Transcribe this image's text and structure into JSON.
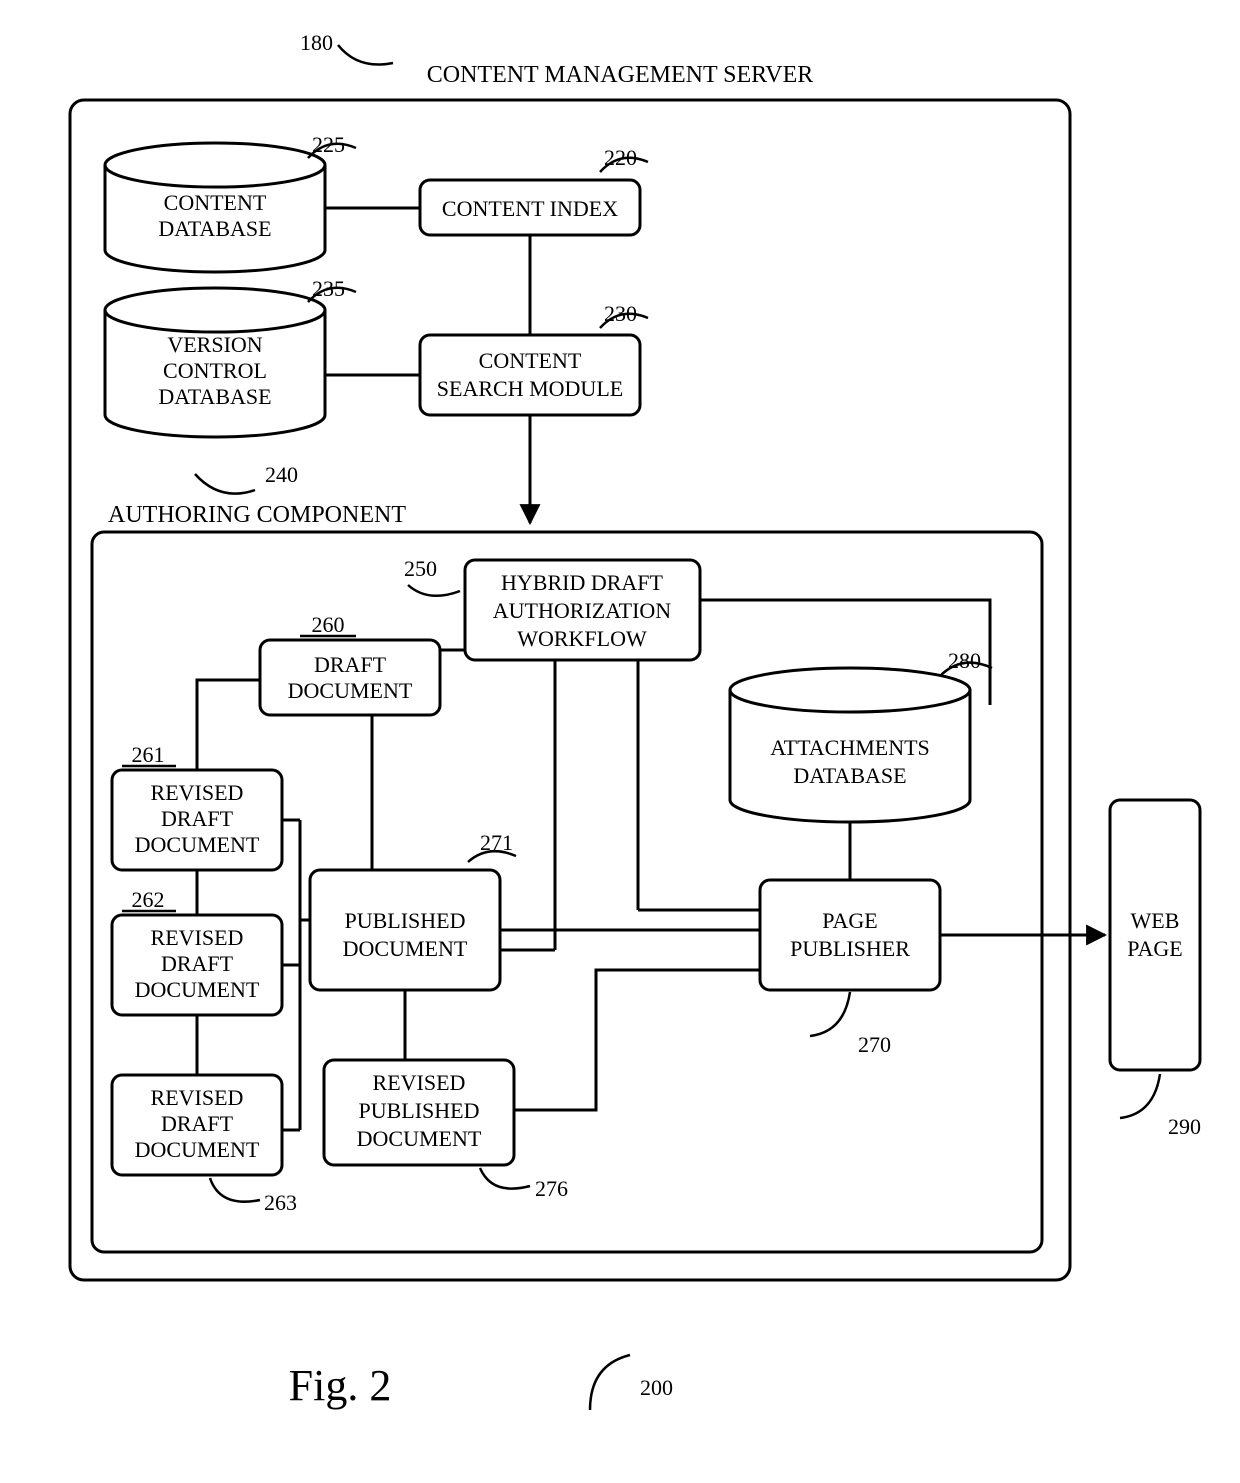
{
  "figure": {
    "title": "CONTENT MANAGEMENT SERVER",
    "caption": "Fig. 2"
  },
  "refs": {
    "server": "180",
    "contentDb": "225",
    "contentIndex": "220",
    "versionDb": "235",
    "searchModule": "230",
    "authoring": "240",
    "workflow": "250",
    "draft": "260",
    "rev1": "261",
    "rev2": "262",
    "rev3": "263",
    "pagePub": "270",
    "published": "271",
    "revPub": "276",
    "attachDb": "280",
    "webPage": "290",
    "figure": "200"
  },
  "labels": {
    "contentDb1": "CONTENT",
    "contentDb2": "DATABASE",
    "contentIndex": "CONTENT INDEX",
    "versionDb1": "VERSION",
    "versionDb2": "CONTROL",
    "versionDb3": "DATABASE",
    "searchModule1": "CONTENT",
    "searchModule2": "SEARCH MODULE",
    "authoring": "AUTHORING COMPONENT",
    "workflow1": "HYBRID DRAFT",
    "workflow2": "AUTHORIZATION",
    "workflow3": "WORKFLOW",
    "draft1": "DRAFT",
    "draft2": "DOCUMENT",
    "rev1": "REVISED",
    "rev2": "DRAFT",
    "rev3": "DOCUMENT",
    "published1": "PUBLISHED",
    "published2": "DOCUMENT",
    "revPub1": "REVISED",
    "revPub2": "PUBLISHED",
    "revPub3": "DOCUMENT",
    "attachDb1": "ATTACHMENTS",
    "attachDb2": "DATABASE",
    "pagePub1": "PAGE",
    "pagePub2": "PUBLISHER",
    "webPage1": "WEB",
    "webPage2": "PAGE"
  }
}
